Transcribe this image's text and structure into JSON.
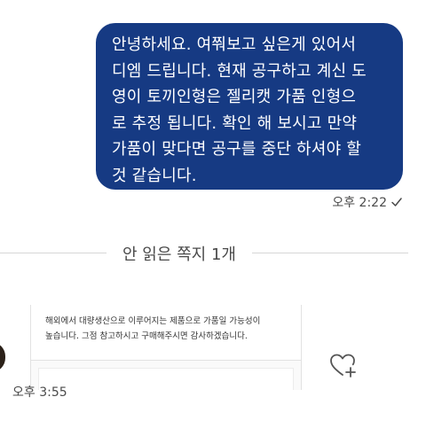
{
  "sent_message": {
    "lines": [
      "안녕하세요. 여쭤보고 싶은게 있어서",
      "디엠 드립니다. 현재 공구하고 계신 도",
      "영이 토끼인형은 젤리캣 가품 인형으",
      "로 추정 됩니다. 확인 해 보시고 만약",
      "가품이 맞다면 공구를 중단 하셔야 할",
      "것 같습니다."
    ],
    "time": "오후 2:22",
    "status_icon": "check-icon",
    "bubble_color": "#163a83"
  },
  "divider": {
    "label": "안 읽은 쪽지 1개"
  },
  "received_message": {
    "card_lines": [
      "해외에서 대량생산으로 이루어지는 제품으로 가품일 가능성이",
      "높습니다. 그점 참고하시고 구매해주시면 감사하겠습니다."
    ],
    "time": "오후 3:55",
    "react_icon": "heart-plus-icon"
  }
}
